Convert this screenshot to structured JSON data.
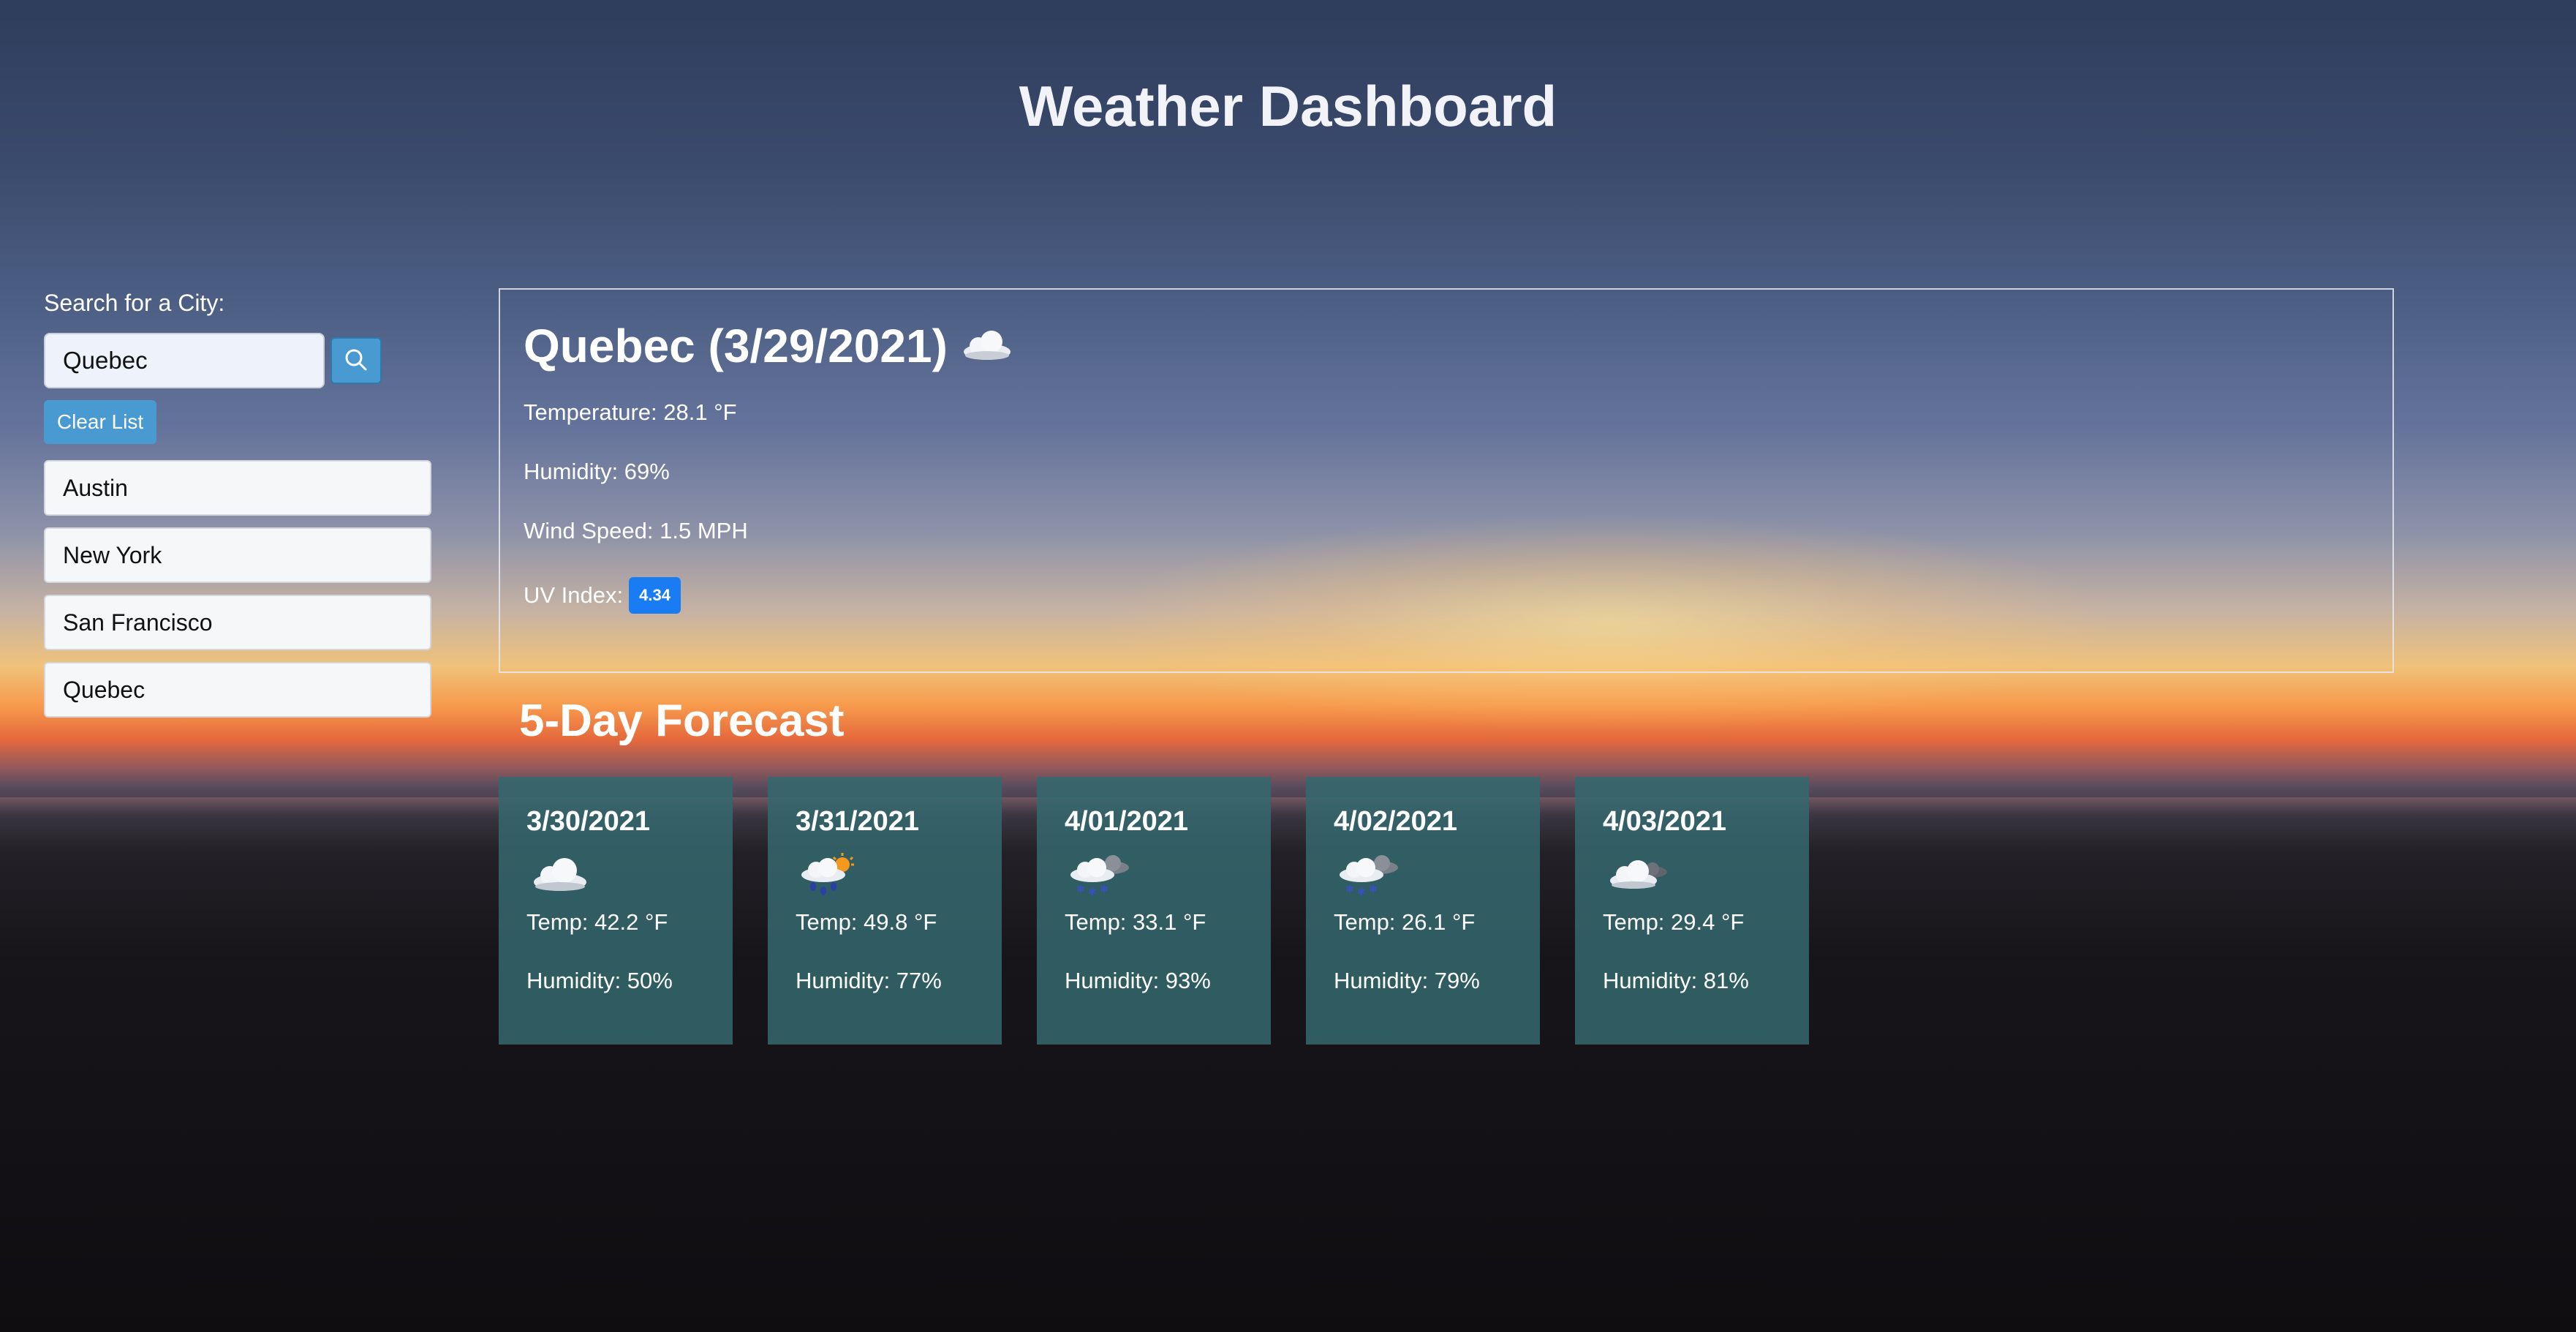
{
  "header": {
    "title": "Weather Dashboard"
  },
  "sidebar": {
    "search_label": "Search for a City:",
    "search_value": "Quebec",
    "search_button_icon": "search-icon",
    "clear_label": "Clear List",
    "cities": [
      "Austin",
      "New York",
      "San Francisco",
      "Quebec"
    ]
  },
  "current": {
    "title": "Quebec (3/29/2021)",
    "icon": "cloud-icon",
    "temperature": "Temperature: 28.1 °F",
    "humidity": "Humidity: 69%",
    "wind": "Wind Speed: 1.5 MPH",
    "uv_label": "UV Index:",
    "uv_value": "4.34",
    "uv_color": "#1a7cf2"
  },
  "forecast": {
    "heading": "5-Day Forecast",
    "days": [
      {
        "date": "3/30/2021",
        "icon": "cloud-icon",
        "temp": "Temp: 42.2 °F",
        "humidity": "Humidity: 50%"
      },
      {
        "date": "3/31/2021",
        "icon": "rain-sun-icon",
        "temp": "Temp: 49.8 °F",
        "humidity": "Humidity: 77%"
      },
      {
        "date": "4/01/2021",
        "icon": "snow-cloud-icon",
        "temp": "Temp: 33.1 °F",
        "humidity": "Humidity: 93%"
      },
      {
        "date": "4/02/2021",
        "icon": "snow-cloud-icon",
        "temp": "Temp: 26.1 °F",
        "humidity": "Humidity: 79%"
      },
      {
        "date": "4/03/2021",
        "icon": "cloud-icon",
        "temp": "Temp: 29.4 °F",
        "humidity": "Humidity: 81%"
      }
    ]
  },
  "colors": {
    "accent": "#4a9ad2",
    "card_background": "#34686e"
  }
}
